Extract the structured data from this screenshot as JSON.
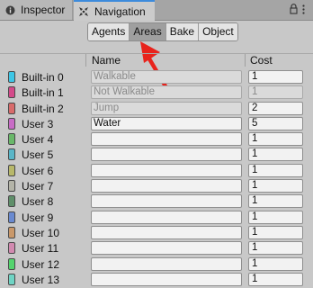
{
  "tabs": [
    {
      "label": "Inspector",
      "icon": "info-icon"
    },
    {
      "label": "Navigation",
      "icon": "navigation-icon"
    }
  ],
  "toolbar": {
    "buttons": [
      "Agents",
      "Areas",
      "Bake",
      "Object"
    ],
    "active": "Areas"
  },
  "table": {
    "name_header": "Name",
    "cost_header": "Cost",
    "rows": [
      {
        "label": "Built-in 0",
        "color": "#3ec6e6",
        "name": "Walkable",
        "name_disabled": true,
        "cost": "1",
        "cost_disabled": false
      },
      {
        "label": "Built-in 1",
        "color": "#d44a8a",
        "name": "Not Walkable",
        "name_disabled": true,
        "cost": "1",
        "cost_disabled": true
      },
      {
        "label": "Built-in 2",
        "color": "#d86b6b",
        "name": "Jump",
        "name_disabled": true,
        "cost": "2",
        "cost_disabled": false
      },
      {
        "label": "User 3",
        "color": "#c86cc6",
        "name": "Water",
        "name_disabled": false,
        "cost": "5",
        "cost_disabled": false
      },
      {
        "label": "User 4",
        "color": "#6ab86a",
        "name": "",
        "name_disabled": false,
        "cost": "1",
        "cost_disabled": false
      },
      {
        "label": "User 5",
        "color": "#5ab6c8",
        "name": "",
        "name_disabled": false,
        "cost": "1",
        "cost_disabled": false
      },
      {
        "label": "User 6",
        "color": "#b8b86a",
        "name": "",
        "name_disabled": false,
        "cost": "1",
        "cost_disabled": false
      },
      {
        "label": "User 7",
        "color": "#b4b4a8",
        "name": "",
        "name_disabled": false,
        "cost": "1",
        "cost_disabled": false
      },
      {
        "label": "User 8",
        "color": "#5f8f6a",
        "name": "",
        "name_disabled": false,
        "cost": "1",
        "cost_disabled": false
      },
      {
        "label": "User 9",
        "color": "#6a8ad0",
        "name": "",
        "name_disabled": false,
        "cost": "1",
        "cost_disabled": false
      },
      {
        "label": "User 10",
        "color": "#c9986a",
        "name": "",
        "name_disabled": false,
        "cost": "1",
        "cost_disabled": false
      },
      {
        "label": "User 11",
        "color": "#d28ab0",
        "name": "",
        "name_disabled": false,
        "cost": "1",
        "cost_disabled": false
      },
      {
        "label": "User 12",
        "color": "#54d46e",
        "name": "",
        "name_disabled": false,
        "cost": "1",
        "cost_disabled": false
      },
      {
        "label": "User 13",
        "color": "#6fd4c4",
        "name": "",
        "name_disabled": false,
        "cost": "1",
        "cost_disabled": false
      }
    ]
  },
  "annotation": {
    "arrow_color": "#e8231c"
  }
}
